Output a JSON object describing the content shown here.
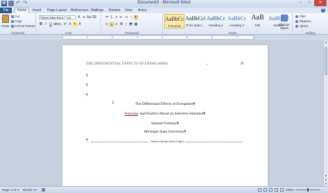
{
  "app": {
    "window_title": "Document3 - Microsoft Word",
    "controls": {
      "minimize": "–",
      "maximize": "□",
      "close": "✕"
    }
  },
  "tabs": [
    "File",
    "Home",
    "Insert",
    "Page Layout",
    "References",
    "Mailings",
    "Review",
    "View",
    "Avery"
  ],
  "active_tab": "Home",
  "ribbon": {
    "clipboard": {
      "paste": "Paste",
      "cut": "Cut",
      "copy": "Copy",
      "format_painter": "Format Painter",
      "label": "Clipboard"
    },
    "font": {
      "font_name": "Times New Rom",
      "font_size": "12",
      "label": "Font"
    },
    "paragraph": {
      "label": "Paragraph"
    },
    "styles": {
      "label": "Styles",
      "items": [
        {
          "sample": "AaBbCcI",
          "name": "¶ Normal"
        },
        {
          "sample": "AaBbCcI",
          "name": "¶ No Spaci..."
        },
        {
          "sample": "AaBbCc",
          "name": "Heading 1"
        },
        {
          "sample": "AaBbCc",
          "name": "Heading 2"
        },
        {
          "sample": "AaB",
          "name": "Title"
        },
        {
          "sample": "AaBbCcI",
          "name": "Subtitle"
        }
      ],
      "change_styles": "Change Styles"
    },
    "editing": {
      "find": "Find",
      "replace": "Replace",
      "select": "Select",
      "label": "Editing"
    }
  },
  "ruler": {
    "numbers": [
      "1",
      "2",
      "3",
      "4",
      "5",
      "6",
      "7"
    ]
  },
  "document": {
    "running_head": "THE DIFFERENTIAL EFFECTS OF EXERGAMES",
    "page_number": "1¶",
    "tab_arrow": "→",
    "empty_para": "¶",
    "title_line1": "The Differential Effects of Exergames¶",
    "title_line2_underlined": "Exercise",
    "title_line2_rest": ", and Positive Mood on Selective Attention¶",
    "author": "Samuel Fortenay¶",
    "affiliation": "Michigan State University¶",
    "section_break": "Section Break (Next Page)",
    "cursor": "I"
  },
  "status": {
    "page": "Page: 2 of 2",
    "words": "Words: 17",
    "zoom": "100%"
  }
}
